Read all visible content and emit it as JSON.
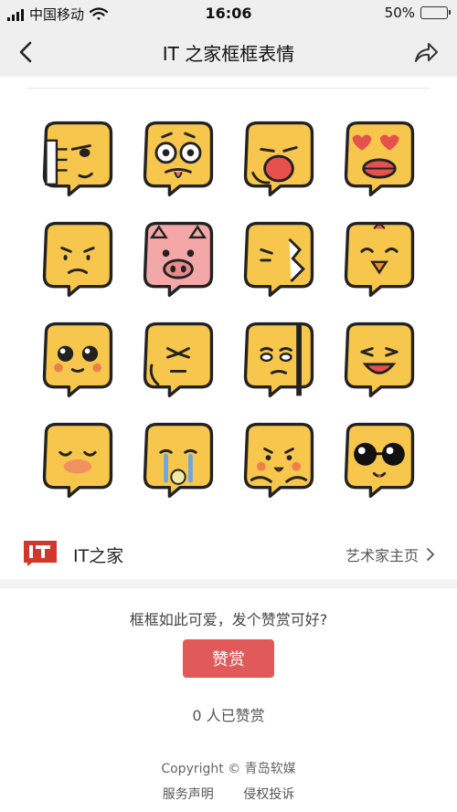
{
  "status_bar": {
    "carrier": "中国移动",
    "time": "16:06",
    "battery": "50%",
    "battery_level": 0.5
  },
  "nav": {
    "title": "IT 之家框框表情"
  },
  "stickers": [
    {
      "name": "thumbs-up-face",
      "color": "#f7c64c"
    },
    {
      "name": "googly-eyes-face",
      "color": "#f7c64c"
    },
    {
      "name": "yawning-face",
      "color": "#f7c64c"
    },
    {
      "name": "heart-eyes-lips-face",
      "color": "#f7c64c"
    },
    {
      "name": "worried-face",
      "color": "#f7c64c"
    },
    {
      "name": "pig-face",
      "color": "#f3a7a7"
    },
    {
      "name": "broken-face",
      "color": "#f7c64c"
    },
    {
      "name": "chick-face",
      "color": "#f7c64c"
    },
    {
      "name": "big-eyes-face",
      "color": "#f7c64c"
    },
    {
      "name": "squinting-face",
      "color": "#f7c64c"
    },
    {
      "name": "peeking-face",
      "color": "#f7c64c"
    },
    {
      "name": "laughing-face",
      "color": "#f7c64c"
    },
    {
      "name": "blushing-face",
      "color": "#f7c64c"
    },
    {
      "name": "crying-face",
      "color": "#f7c64c"
    },
    {
      "name": "shy-face",
      "color": "#f7c64c"
    },
    {
      "name": "sunglasses-face",
      "color": "#f7c64c"
    }
  ],
  "author": {
    "logo_text": "IT",
    "name": "IT之家",
    "link_label": "艺术家主页"
  },
  "reward": {
    "prompt": "框框如此可爱，发个赞赏可好?",
    "button_label": "赞赏",
    "count_text": "0 人已赞赏",
    "accent": "#e05a5a"
  },
  "footer": {
    "copyright": "Copyright © 青岛软媒",
    "service": "服务声明",
    "complaint": "侵权投诉"
  }
}
